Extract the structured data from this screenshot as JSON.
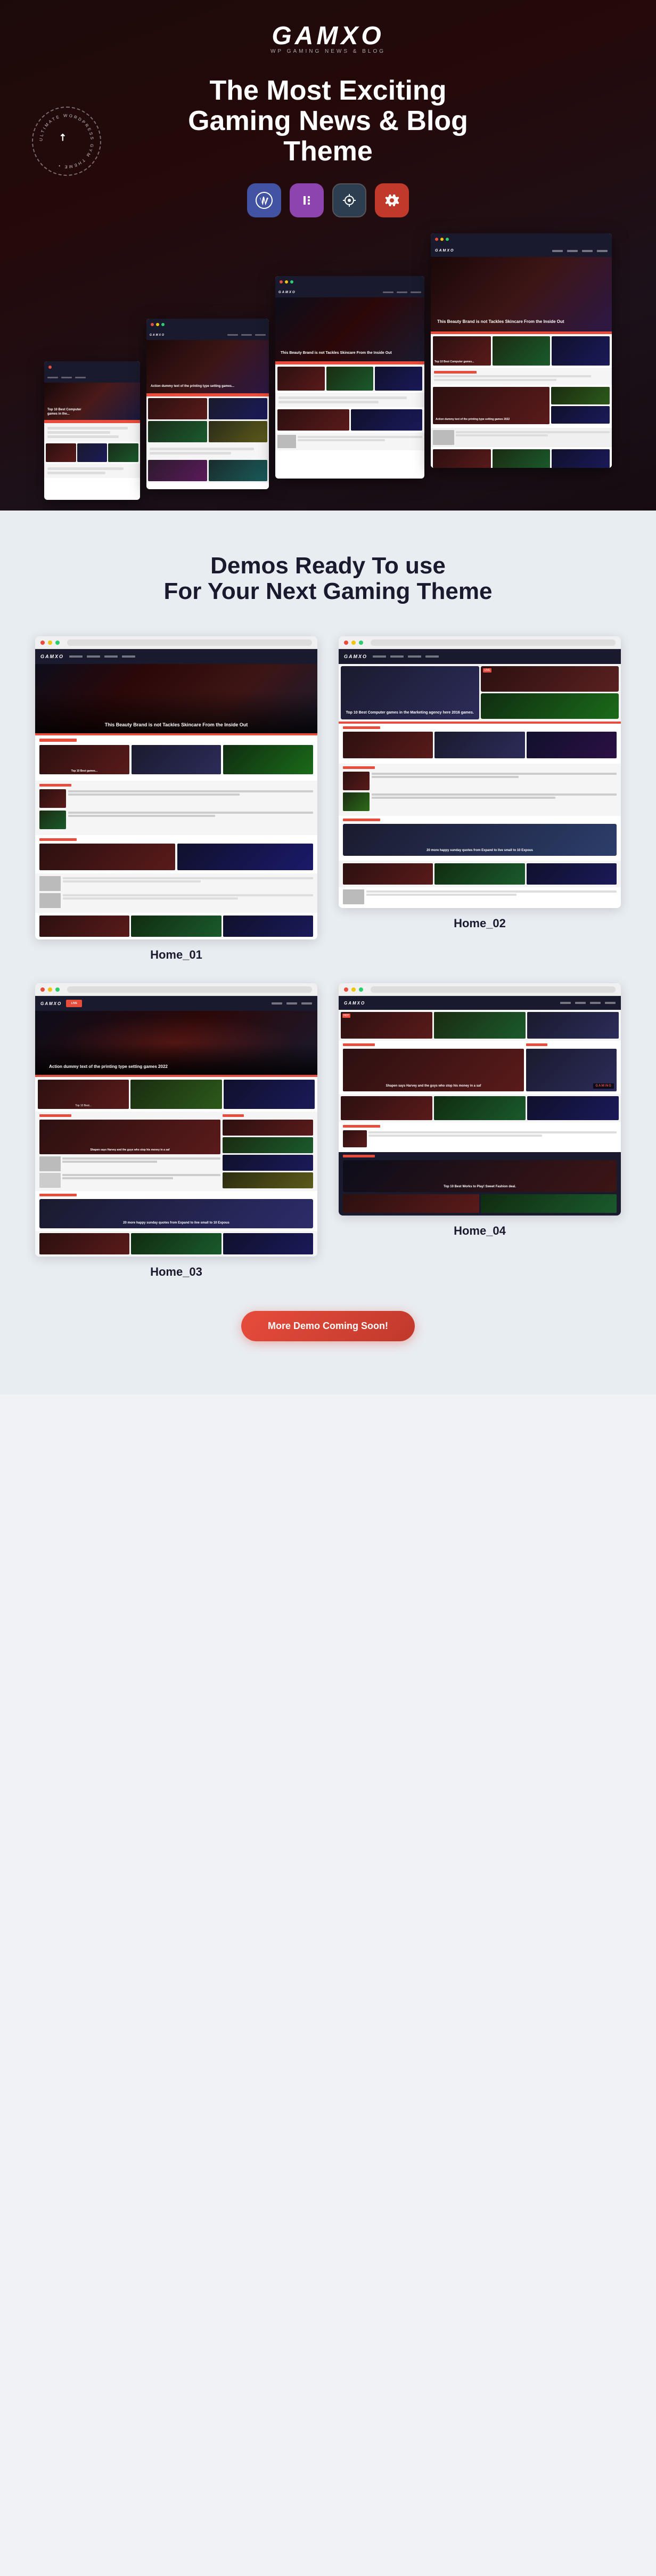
{
  "hero": {
    "logo_text": "GAMXO",
    "logo_subtitle": "WP GAMING NEWS & BLOG",
    "title_line1": "The Most Exciting",
    "title_line2": "Gaming News & Blog Theme",
    "circle_badge": "ULTIMATE WORDPRESS GYM THEME",
    "icons": [
      {
        "name": "wordpress-icon",
        "label": "WordPress",
        "class": "icon-wp"
      },
      {
        "name": "elementor-icon",
        "label": "Elementor",
        "class": "icon-el"
      },
      {
        "name": "octo-icon",
        "label": "Octopus",
        "class": "icon-octo"
      },
      {
        "name": "settings-icon",
        "label": "Settings",
        "class": "icon-set"
      }
    ]
  },
  "demos_section": {
    "title_line1": "Demos Ready To use",
    "title_line2": "For Your Next Gaming Theme",
    "demos": [
      {
        "id": "home01",
        "label": "Home_01"
      },
      {
        "id": "home02",
        "label": "Home_02"
      },
      {
        "id": "home03",
        "label": "Home_03"
      },
      {
        "id": "home04",
        "label": "Home_04"
      }
    ],
    "more_button": "More Demo Coming Soon!",
    "featured_text": "This Beauty Brand is not Tackles Skincare From the Inside Out",
    "featured_text2": "Top 10 Best Computer games in the Marketing agency here 2016 games.",
    "article_text1": "Shapen says Harvey and the guys who stop his money in a saf",
    "article_text2": "Action dummy text of the printing type setting games 2022",
    "article_text3": "20 more happy sunday quotes from Expand to live small to 10 Expous"
  }
}
